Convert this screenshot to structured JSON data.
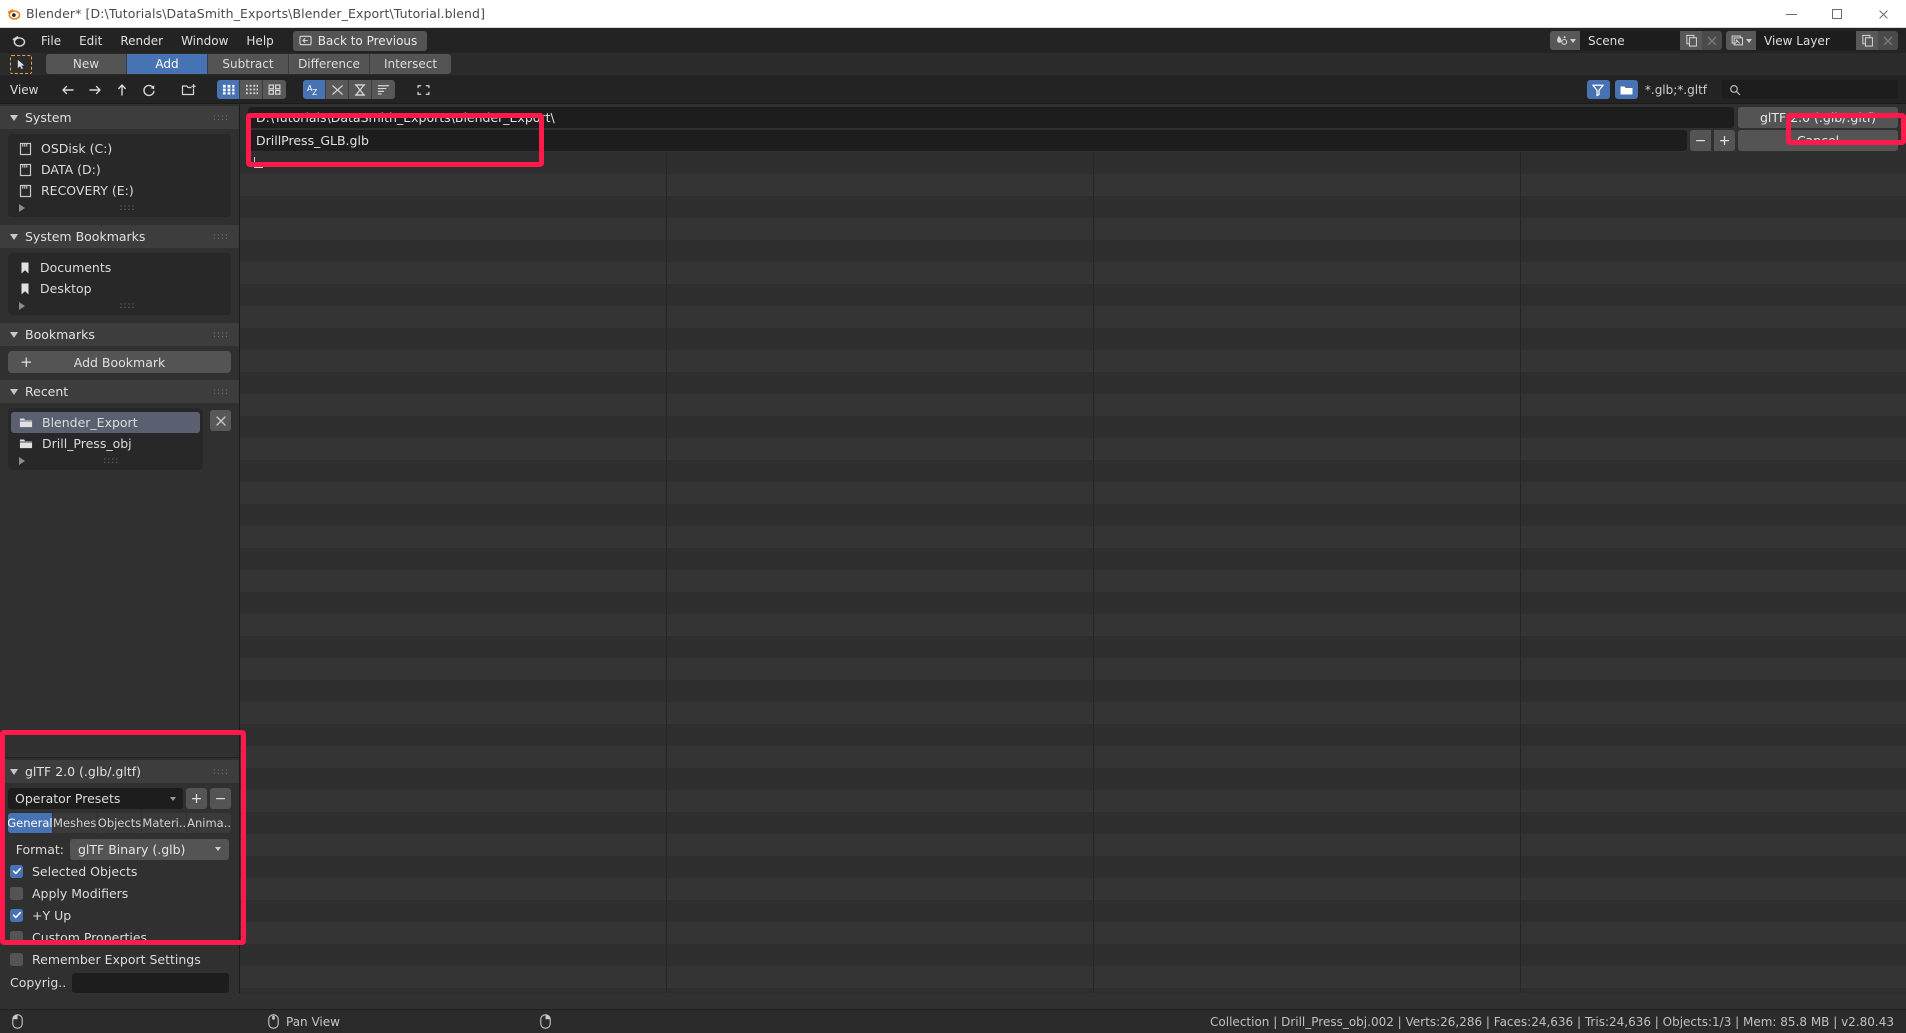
{
  "window": {
    "title": "Blender* [D:\\Tutorials\\DataSmith_Exports\\Blender_Export\\Tutorial.blend]",
    "logo_icon": "blender-logo-icon",
    "minimize_icon": "minimize-icon",
    "maximize_icon": "maximize-icon",
    "close_icon": "close-icon"
  },
  "topbar": {
    "app_icon": "blender-icon",
    "menus": [
      "File",
      "Edit",
      "Render",
      "Window",
      "Help"
    ],
    "back_button": {
      "label": "Back to Previous",
      "icon": "back-arrow-icon"
    },
    "scene": {
      "icon": "scene-data-icon",
      "value": "Scene",
      "copy_icon": "new-datablock-icon",
      "unlink_icon": "unlink-icon"
    },
    "view_layer": {
      "icon": "view-layer-icon",
      "value": "View Layer",
      "copy_icon": "new-datablock-icon",
      "unlink_icon": "unlink-icon"
    }
  },
  "modebar": {
    "cursor_icon": "select-cursor-icon",
    "buttons": [
      {
        "label": "New",
        "active": false
      },
      {
        "label": "Add",
        "active": true
      },
      {
        "label": "Subtract",
        "active": false
      },
      {
        "label": "Difference",
        "active": false
      },
      {
        "label": "Intersect",
        "active": false
      }
    ]
  },
  "file_header": {
    "view_menu": "View",
    "nav_icons": [
      "back-arrow-icon",
      "forward-arrow-icon",
      "up-arrow-icon",
      "refresh-icon"
    ],
    "new_folder_icon": "new-folder-icon",
    "display_modes": [
      {
        "icon": "list-view-icon",
        "active": true
      },
      {
        "icon": "detail-list-icon",
        "active": false
      },
      {
        "icon": "thumbnail-grid-icon",
        "active": false
      }
    ],
    "sort_modes": [
      {
        "icon": "sort-alphabetical-icon",
        "active": true
      },
      {
        "icon": "sort-extension-icon",
        "active": false
      },
      {
        "icon": "sort-time-icon",
        "active": false
      },
      {
        "icon": "sort-size-icon",
        "active": false
      }
    ],
    "select_box_icon": "select-box-icon",
    "filter_icon": "filter-funnel-icon",
    "folder_filter_icon": "folder-filter-icon",
    "filter_text": "*.glb;*.gltf",
    "search_icon": "search-icon",
    "search_placeholder": ""
  },
  "sidebar": {
    "sections": [
      {
        "title": "System",
        "icon": "disclosure-triangle-icon",
        "items": [
          {
            "label": "OSDisk (C:)",
            "icon": "drive-icon"
          },
          {
            "label": "DATA (D:)",
            "icon": "drive-icon"
          },
          {
            "label": "RECOVERY (E:)",
            "icon": "drive-icon"
          }
        ]
      },
      {
        "title": "System Bookmarks",
        "icon": "disclosure-triangle-icon",
        "items": [
          {
            "label": "Documents",
            "icon": "bookmark-icon"
          },
          {
            "label": "Desktop",
            "icon": "bookmark-icon"
          }
        ]
      },
      {
        "title": "Bookmarks",
        "icon": "disclosure-triangle-icon",
        "add_button": {
          "label": "Add Bookmark",
          "icon": "plus-icon"
        }
      },
      {
        "title": "Recent",
        "icon": "disclosure-triangle-icon",
        "clear_icon": "clear-recent-icon",
        "items": [
          {
            "label": "Blender_Export",
            "icon": "folder-icon",
            "selected": true
          },
          {
            "label": "Drill_Press_obj",
            "icon": "folder-icon",
            "selected": false
          }
        ]
      }
    ]
  },
  "operator_panel": {
    "title": "glTF 2.0 (.glb/.gltf)",
    "presets": {
      "value": "Operator Presets",
      "add_icon": "plus-icon",
      "remove_icon": "minus-icon"
    },
    "tabs": [
      {
        "label": "General",
        "active": true
      },
      {
        "label": "Meshes",
        "active": false
      },
      {
        "label": "Objects",
        "active": false
      },
      {
        "label": "Materi..",
        "active": false
      },
      {
        "label": "Anima..",
        "active": false
      }
    ],
    "format": {
      "label": "Format:",
      "value": "glTF Binary (.glb)"
    },
    "checkboxes": [
      {
        "label": "Selected Objects",
        "checked": true
      },
      {
        "label": "Apply Modifiers",
        "checked": false
      },
      {
        "label": "+Y Up",
        "checked": true
      },
      {
        "label": "Custom Properties",
        "checked": false
      },
      {
        "label": "Remember Export Settings",
        "checked": false
      }
    ],
    "copyright": {
      "label": "Copyrig..",
      "value": ""
    }
  },
  "file_browser": {
    "path": "D:\\Tutorials\\DataSmith_Exports\\Blender_Export\\",
    "filename": "DrillPress_GLB.glb",
    "decrement_label": "−",
    "increment_label": "+",
    "execute_button": "glTF 2.0 (.glb/.gltf)",
    "cancel_button": "Cancel"
  },
  "statusbar": {
    "mouse_left_icon": "mouse-left-icon",
    "mouse_middle_icon": "mouse-middle-icon",
    "mouse_right_icon": "mouse-right-icon",
    "hint": "Pan View",
    "stats": "Collection | Drill_Press_obj.002 | Verts:26,286 | Faces:24,636 | Tris:24,636 | Objects:1/3 | Mem: 85.8 MB | v2.80.43"
  },
  "annotations": {
    "color": "#ff1a4b",
    "boxes": [
      "path-and-name-fields",
      "export-format-button",
      "export-options-panel"
    ]
  }
}
